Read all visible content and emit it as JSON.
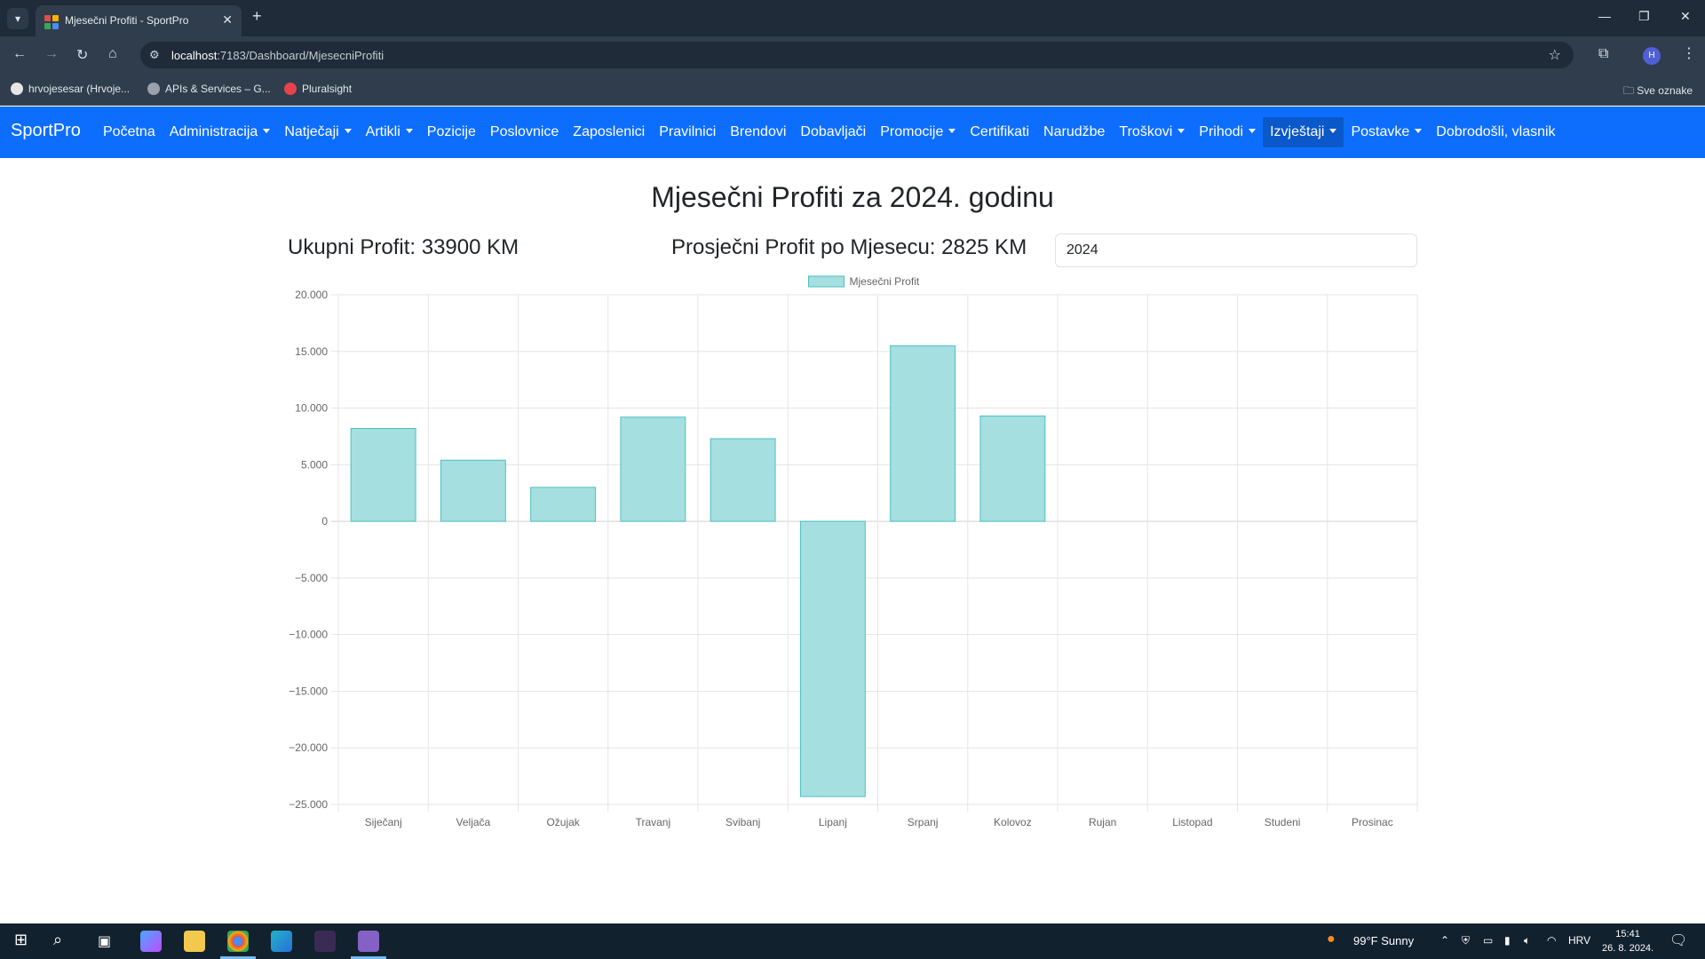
{
  "browser": {
    "tab_title": "Mjesečni Profiti - SportPro",
    "url_host": "localhost",
    "url_path": ":7183/Dashboard/MjesecniProfiti",
    "bookmarks": [
      "hrvojesesar (Hrvoje...",
      "APIs & Services – G...",
      "Pluralsight"
    ],
    "all_bookmarks": "Sve oznake",
    "profile_initial": "H"
  },
  "navbar": {
    "brand": "SportPro",
    "items": [
      {
        "label": "Početna",
        "dropdown": false
      },
      {
        "label": "Administracija",
        "dropdown": true
      },
      {
        "label": "Natječaji",
        "dropdown": true
      },
      {
        "label": "Artikli",
        "dropdown": true
      },
      {
        "label": "Pozicije",
        "dropdown": false
      },
      {
        "label": "Poslovnice",
        "dropdown": false
      },
      {
        "label": "Zaposlenici",
        "dropdown": false
      },
      {
        "label": "Pravilnici",
        "dropdown": false
      },
      {
        "label": "Brendovi",
        "dropdown": false
      },
      {
        "label": "Dobavljači",
        "dropdown": false
      },
      {
        "label": "Promocije",
        "dropdown": true
      },
      {
        "label": "Certifikati",
        "dropdown": false
      },
      {
        "label": "Narudžbe",
        "dropdown": false
      },
      {
        "label": "Troškovi",
        "dropdown": true
      },
      {
        "label": "Prihodi",
        "dropdown": true
      },
      {
        "label": "Izvještaji",
        "dropdown": true,
        "active": true
      },
      {
        "label": "Postavke",
        "dropdown": true
      },
      {
        "label": "Dobrodošli, vlasnik",
        "dropdown": false
      }
    ],
    "color": "#0d6efd",
    "active_color": "#0a58ca"
  },
  "page": {
    "title": "Mjesečni Profiti za 2024. godinu",
    "total": "Ukupni Profit: 33900 KM",
    "average": "Prosječni Profit po Mjesecu: 2825 KM",
    "year_value": "2024"
  },
  "chart_data": {
    "type": "bar",
    "categories": [
      "Siječanj",
      "Veljača",
      "Ožujak",
      "Travanj",
      "Svibanj",
      "Lipanj",
      "Srpanj",
      "Kolovoz",
      "Rujan",
      "Listopad",
      "Studeni",
      "Prosinac"
    ],
    "series": [
      {
        "name": "Mjesečni Profit",
        "values": [
          8200,
          5400,
          3000,
          9200,
          7300,
          -24300,
          15500,
          9300,
          0,
          0,
          0,
          0
        ]
      }
    ],
    "ylim": [
      -25000,
      20000
    ],
    "yticks": [
      20000,
      15000,
      10000,
      5000,
      0,
      -5000,
      -10000,
      -15000,
      -20000,
      -25000
    ],
    "ytick_labels": [
      "20.000",
      "15.000",
      "10.000",
      "5.000",
      "0",
      "−5.000",
      "−10.000",
      "−15.000",
      "−20.000",
      "−25.000"
    ],
    "grid": true,
    "legend": "top-center",
    "bar_fill": "#a6dfe0",
    "bar_stroke": "#4bc0c0"
  },
  "taskbar": {
    "weather": "99°F  Sunny",
    "language": "HRV",
    "time": "15:41",
    "date": "26. 8. 2024."
  }
}
